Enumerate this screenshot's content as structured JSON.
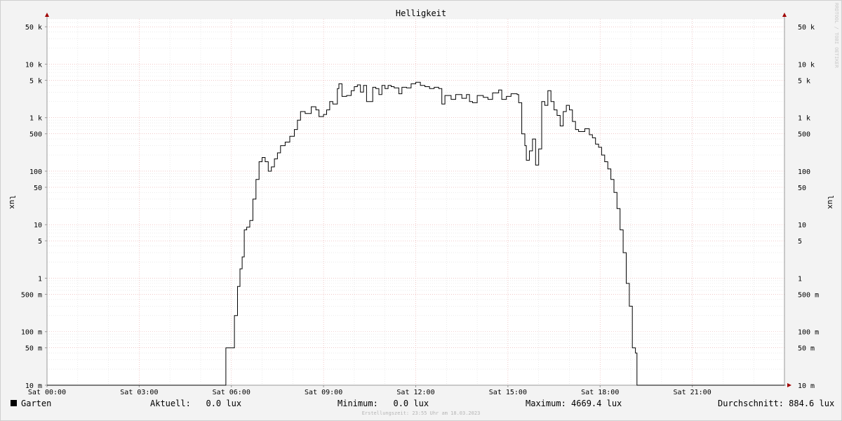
{
  "chart_data": {
    "type": "line",
    "title": "Helligkeit",
    "ylabel": "lux",
    "y_scale": "log",
    "ylim": [
      0.01,
      70000
    ],
    "y_ticks": [
      {
        "v": 0.01,
        "label": "10 m"
      },
      {
        "v": 0.05,
        "label": "50 m"
      },
      {
        "v": 0.1,
        "label": "100 m"
      },
      {
        "v": 0.5,
        "label": "500 m"
      },
      {
        "v": 1,
        "label": "1"
      },
      {
        "v": 5,
        "label": "5"
      },
      {
        "v": 10,
        "label": "10"
      },
      {
        "v": 50,
        "label": "50"
      },
      {
        "v": 100,
        "label": "100"
      },
      {
        "v": 500,
        "label": "500"
      },
      {
        "v": 1000,
        "label": "1 k"
      },
      {
        "v": 5000,
        "label": "5 k"
      },
      {
        "v": 10000,
        "label": "10 k"
      },
      {
        "v": 50000,
        "label": "50 k"
      }
    ],
    "x_unit": "hours",
    "xlim": [
      0,
      24
    ],
    "x_ticks": [
      {
        "v": 0,
        "label": "Sat 00:00"
      },
      {
        "v": 3,
        "label": "Sat 03:00"
      },
      {
        "v": 6,
        "label": "Sat 06:00"
      },
      {
        "v": 9,
        "label": "Sat 09:00"
      },
      {
        "v": 12,
        "label": "Sat 12:00"
      },
      {
        "v": 15,
        "label": "Sat 15:00"
      },
      {
        "v": 18,
        "label": "Sat 18:00"
      },
      {
        "v": 21,
        "label": "Sat 21:00"
      }
    ],
    "grid": true,
    "series": [
      {
        "name": "Garten",
        "color": "#000000",
        "points": [
          [
            0,
            0
          ],
          [
            5.8,
            0
          ],
          [
            5.82,
            0.05
          ],
          [
            6.05,
            0.05
          ],
          [
            6.1,
            0.2
          ],
          [
            6.2,
            0.7
          ],
          [
            6.28,
            1.5
          ],
          [
            6.35,
            2.5
          ],
          [
            6.42,
            8
          ],
          [
            6.5,
            9
          ],
          [
            6.6,
            12
          ],
          [
            6.7,
            30
          ],
          [
            6.8,
            70
          ],
          [
            6.9,
            150
          ],
          [
            7.0,
            180
          ],
          [
            7.1,
            150
          ],
          [
            7.2,
            100
          ],
          [
            7.3,
            120
          ],
          [
            7.4,
            170
          ],
          [
            7.5,
            220
          ],
          [
            7.6,
            300
          ],
          [
            7.75,
            350
          ],
          [
            7.9,
            450
          ],
          [
            8.05,
            600
          ],
          [
            8.15,
            900
          ],
          [
            8.25,
            1300
          ],
          [
            8.4,
            1200
          ],
          [
            8.6,
            1600
          ],
          [
            8.75,
            1400
          ],
          [
            8.85,
            1050
          ],
          [
            9.0,
            1150
          ],
          [
            9.1,
            1400
          ],
          [
            9.2,
            2000
          ],
          [
            9.3,
            1800
          ],
          [
            9.45,
            3500
          ],
          [
            9.5,
            4300
          ],
          [
            9.6,
            2500
          ],
          [
            9.75,
            2600
          ],
          [
            9.9,
            3200
          ],
          [
            10.0,
            3800
          ],
          [
            10.1,
            4100
          ],
          [
            10.2,
            3000
          ],
          [
            10.3,
            4000
          ],
          [
            10.4,
            2000
          ],
          [
            10.5,
            2000
          ],
          [
            10.6,
            3700
          ],
          [
            10.7,
            3500
          ],
          [
            10.8,
            2700
          ],
          [
            10.9,
            4000
          ],
          [
            11.0,
            3500
          ],
          [
            11.1,
            4000
          ],
          [
            11.2,
            3800
          ],
          [
            11.3,
            3600
          ],
          [
            11.45,
            2800
          ],
          [
            11.55,
            3700
          ],
          [
            11.7,
            3600
          ],
          [
            11.85,
            4300
          ],
          [
            12.0,
            4600
          ],
          [
            12.15,
            4000
          ],
          [
            12.3,
            3800
          ],
          [
            12.45,
            3500
          ],
          [
            12.6,
            3700
          ],
          [
            12.75,
            3500
          ],
          [
            12.85,
            1800
          ],
          [
            12.95,
            2600
          ],
          [
            13.15,
            2200
          ],
          [
            13.3,
            2700
          ],
          [
            13.5,
            2300
          ],
          [
            13.65,
            2700
          ],
          [
            13.75,
            2000
          ],
          [
            13.85,
            1900
          ],
          [
            14.0,
            2600
          ],
          [
            14.2,
            2400
          ],
          [
            14.35,
            2200
          ],
          [
            14.5,
            2900
          ],
          [
            14.7,
            3300
          ],
          [
            14.8,
            2200
          ],
          [
            14.95,
            2500
          ],
          [
            15.1,
            2800
          ],
          [
            15.3,
            2700
          ],
          [
            15.35,
            1900
          ],
          [
            15.45,
            500
          ],
          [
            15.55,
            300
          ],
          [
            15.6,
            160
          ],
          [
            15.7,
            240
          ],
          [
            15.8,
            400
          ],
          [
            15.9,
            130
          ],
          [
            16.0,
            260
          ],
          [
            16.1,
            2000
          ],
          [
            16.2,
            1700
          ],
          [
            16.3,
            3200
          ],
          [
            16.4,
            2000
          ],
          [
            16.5,
            1400
          ],
          [
            16.6,
            1100
          ],
          [
            16.7,
            700
          ],
          [
            16.8,
            1300
          ],
          [
            16.9,
            1700
          ],
          [
            17.0,
            1400
          ],
          [
            17.1,
            850
          ],
          [
            17.2,
            600
          ],
          [
            17.3,
            550
          ],
          [
            17.5,
            620
          ],
          [
            17.65,
            480
          ],
          [
            17.75,
            420
          ],
          [
            17.85,
            320
          ],
          [
            17.95,
            280
          ],
          [
            18.05,
            200
          ],
          [
            18.15,
            150
          ],
          [
            18.25,
            110
          ],
          [
            18.35,
            70
          ],
          [
            18.45,
            40
          ],
          [
            18.55,
            20
          ],
          [
            18.65,
            8
          ],
          [
            18.75,
            3
          ],
          [
            18.85,
            0.8
          ],
          [
            18.95,
            0.3
          ],
          [
            19.05,
            0.05
          ],
          [
            19.15,
            0.04
          ],
          [
            19.2,
            0
          ],
          [
            24,
            0
          ]
        ]
      }
    ]
  },
  "legend": {
    "series_name": "Garten",
    "current": "Aktuell:   0.0 lux",
    "minimum": "Minimum:   0.0 lux",
    "maximum": "Maximum: 4669.4 lux",
    "average": "Durchschnitt: 884.6 lux"
  },
  "footer": "Erstellungszeit: 23:55 Uhr am 18.03.2023",
  "credit": "RRDTOOL / TOBI OETIKER"
}
